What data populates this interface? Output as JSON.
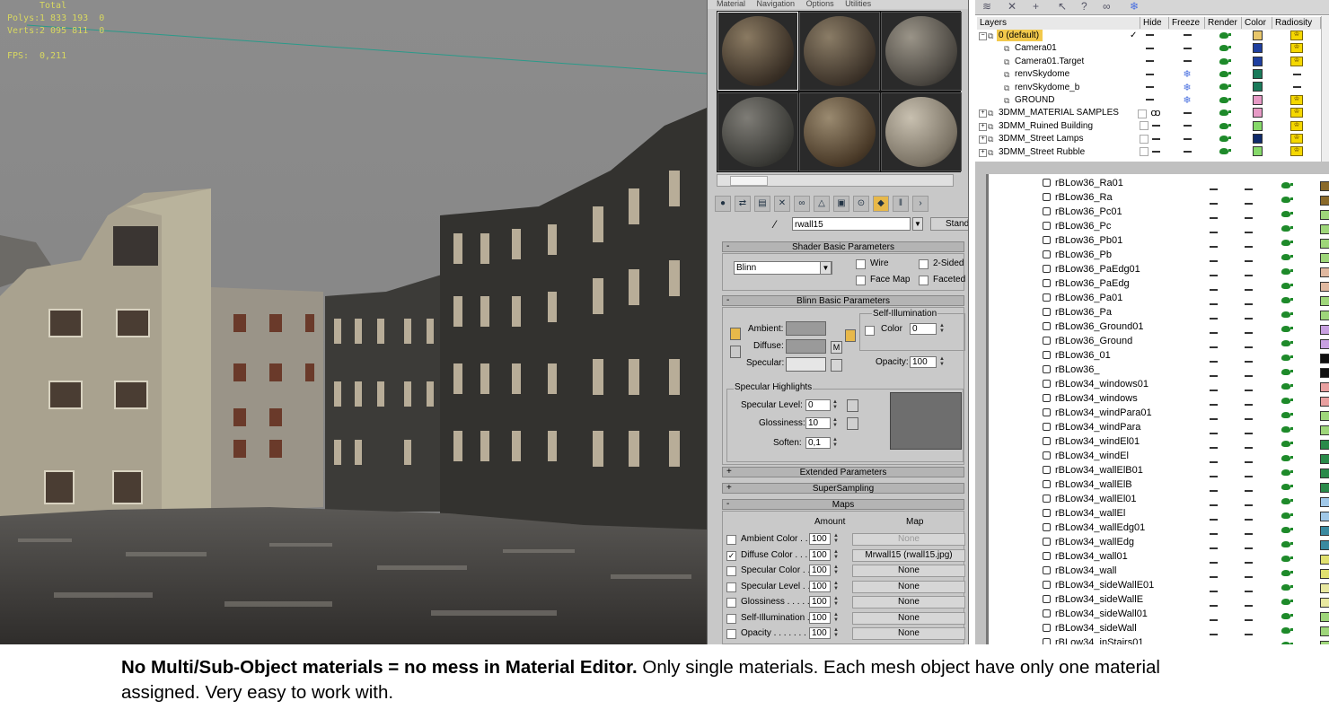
{
  "viewport": {
    "stats": {
      "total_label": "Total",
      "polys_label": "Polys:",
      "polys_value": "1 833 193  0",
      "verts_label": "Verts:",
      "verts_value": "2 095 811  0",
      "fps_label": "FPS:",
      "fps_value": "0,211"
    }
  },
  "material_editor": {
    "menu": [
      "Material",
      "Navigation",
      "Options",
      "Utilities"
    ],
    "material_name": "rwall15",
    "type_button": "Standa",
    "shader_basic": {
      "title": "Shader Basic Parameters",
      "shader": "Blinn",
      "wire": "Wire",
      "two_sided": "2-Sided",
      "face_map": "Face Map",
      "faceted": "Faceted"
    },
    "blinn_basic": {
      "title": "Blinn Basic Parameters",
      "ambient": "Ambient:",
      "diffuse": "Diffuse:",
      "specular": "Specular:",
      "m_button": "M",
      "self_illum_title": "Self-Illumination",
      "self_illum_color": "Color",
      "self_illum_value": "0",
      "opacity_label": "Opacity:",
      "opacity_value": "100",
      "spec_hl_title": "Specular Highlights",
      "spec_level_label": "Specular Level:",
      "spec_level_value": "0",
      "glossiness_label": "Glossiness:",
      "glossiness_value": "10",
      "soften_label": "Soften:",
      "soften_value": "0,1"
    },
    "rollouts": {
      "extended": "Extended Parameters",
      "supersampling": "SuperSampling",
      "maps": "Maps"
    },
    "maps_header": {
      "amount": "Amount",
      "map": "Map"
    },
    "maps": [
      {
        "label": "Ambient Color . .",
        "amount": "100",
        "map": "None",
        "checked": false,
        "disabled": true
      },
      {
        "label": "Diffuse Color . . . .",
        "amount": "100",
        "map": "Mrwall15 (rwall15.jpg)",
        "checked": true,
        "disabled": false
      },
      {
        "label": "Specular Color . .",
        "amount": "100",
        "map": "None",
        "checked": false,
        "disabled": false
      },
      {
        "label": "Specular Level . .",
        "amount": "100",
        "map": "None",
        "checked": false,
        "disabled": false
      },
      {
        "label": "Glossiness . . . . .",
        "amount": "100",
        "map": "None",
        "checked": false,
        "disabled": false
      },
      {
        "label": "Self-Illumination .",
        "amount": "100",
        "map": "None",
        "checked": false,
        "disabled": false
      },
      {
        "label": "Opacity . . . . . . . .",
        "amount": "100",
        "map": "None",
        "checked": false,
        "disabled": false
      }
    ]
  },
  "layers": {
    "columns": [
      "Layers",
      "Hide",
      "Freeze",
      "Render",
      "Color",
      "Radiosity"
    ],
    "rows": [
      {
        "name": "0 (default)",
        "level": 0,
        "kind": "layer",
        "selected": true,
        "check": "✓",
        "hide": "dash",
        "freeze": "dash",
        "color": "#e8c66a",
        "rad": true
      },
      {
        "name": "Camera01",
        "level": 1,
        "kind": "obj",
        "hide": "dash",
        "freeze": "dash",
        "color": "#1f3f9f",
        "rad": true
      },
      {
        "name": "Camera01.Target",
        "level": 1,
        "kind": "obj",
        "hide": "dash",
        "freeze": "dash",
        "color": "#1f3f9f",
        "rad": true
      },
      {
        "name": "renvSkydome",
        "level": 1,
        "kind": "obj",
        "hide": "dash",
        "freeze": "snow",
        "color": "#1a7a5a",
        "rad": false
      },
      {
        "name": "renvSkydome_b",
        "level": 1,
        "kind": "obj",
        "hide": "dash",
        "freeze": "snow",
        "color": "#1a7a5a",
        "rad": false
      },
      {
        "name": "GROUND",
        "level": 1,
        "kind": "obj",
        "hide": "dash",
        "freeze": "snow",
        "color": "#e79ac6",
        "rad": true
      },
      {
        "name": "3DMM_MATERIAL SAMPLES",
        "level": 0,
        "kind": "layer",
        "hide": "eye",
        "freeze": "dash",
        "color": "#e79ac6",
        "rad": true
      },
      {
        "name": "3DMM_Ruined Building",
        "level": 0,
        "kind": "layer",
        "hide": "dash",
        "freeze": "dash",
        "color": "#86d96a",
        "rad": true
      },
      {
        "name": "3DMM_Street Lamps",
        "level": 0,
        "kind": "layer",
        "hide": "dash",
        "freeze": "dash",
        "color": "#0f2a6a",
        "rad": true
      },
      {
        "name": "3DMM_Street Rubble",
        "level": 0,
        "kind": "layer",
        "hide": "dash",
        "freeze": "dash",
        "color": "#86d96a",
        "rad": true
      }
    ]
  },
  "object_list": [
    {
      "name": "rBLow36_Ra01",
      "color": "#8a6a2a"
    },
    {
      "name": "rBLow36_Ra",
      "color": "#8a6a2a"
    },
    {
      "name": "rBLow36_Pc01",
      "color": "#9ed67a"
    },
    {
      "name": "rBLow36_Pc",
      "color": "#9ed67a"
    },
    {
      "name": "rBLow36_Pb01",
      "color": "#9ed67a"
    },
    {
      "name": "rBLow36_Pb",
      "color": "#9ed67a"
    },
    {
      "name": "rBLow36_PaEdg01",
      "color": "#e0b8a0"
    },
    {
      "name": "rBLow36_PaEdg",
      "color": "#e0b8a0"
    },
    {
      "name": "rBLow36_Pa01",
      "color": "#9ed67a"
    },
    {
      "name": "rBLow36_Pa",
      "color": "#9ed67a"
    },
    {
      "name": "rBLow36_Ground01",
      "color": "#c8a0e0"
    },
    {
      "name": "rBLow36_Ground",
      "color": "#c8a0e0"
    },
    {
      "name": "rBLow36_01",
      "color": "#111111"
    },
    {
      "name": "rBLow36_",
      "color": "#111111"
    },
    {
      "name": "rBLow34_windows01",
      "color": "#e8a0a0"
    },
    {
      "name": "rBLow34_windows",
      "color": "#e8a0a0"
    },
    {
      "name": "rBLow34_windPara01",
      "color": "#9ed67a"
    },
    {
      "name": "rBLow34_windPara",
      "color": "#9ed67a"
    },
    {
      "name": "rBLow34_windEl01",
      "color": "#2a8a4a"
    },
    {
      "name": "rBLow34_windEl",
      "color": "#2a8a4a"
    },
    {
      "name": "rBLow34_wallElB01",
      "color": "#2a8a4a"
    },
    {
      "name": "rBLow34_wallElB",
      "color": "#2a8a4a"
    },
    {
      "name": "rBLow34_wallEl01",
      "color": "#a0c8e8"
    },
    {
      "name": "rBLow34_wallEl",
      "color": "#a0c8e8"
    },
    {
      "name": "rBLow34_wallEdg01",
      "color": "#3a8aa0"
    },
    {
      "name": "rBLow34_wallEdg",
      "color": "#3a8aa0"
    },
    {
      "name": "rBLow34_wall01",
      "color": "#e0e070"
    },
    {
      "name": "rBLow34_wall",
      "color": "#e0e070"
    },
    {
      "name": "rBLow34_sideWallE01",
      "color": "#e8e8a0"
    },
    {
      "name": "rBLow34_sideWallE",
      "color": "#e8e8a0"
    },
    {
      "name": "rBLow34_sideWall01",
      "color": "#9ed67a"
    },
    {
      "name": "rBLow34_sideWall",
      "color": "#9ed67a"
    },
    {
      "name": "rBLow34_inStairs01",
      "color": "#9ed67a"
    }
  ],
  "caption": {
    "bold": "No Multi/Sub-Object materials = no mess in Material Editor.",
    "rest": " Only single materials. Each mesh object have only one material assigned. Very easy to work with."
  }
}
